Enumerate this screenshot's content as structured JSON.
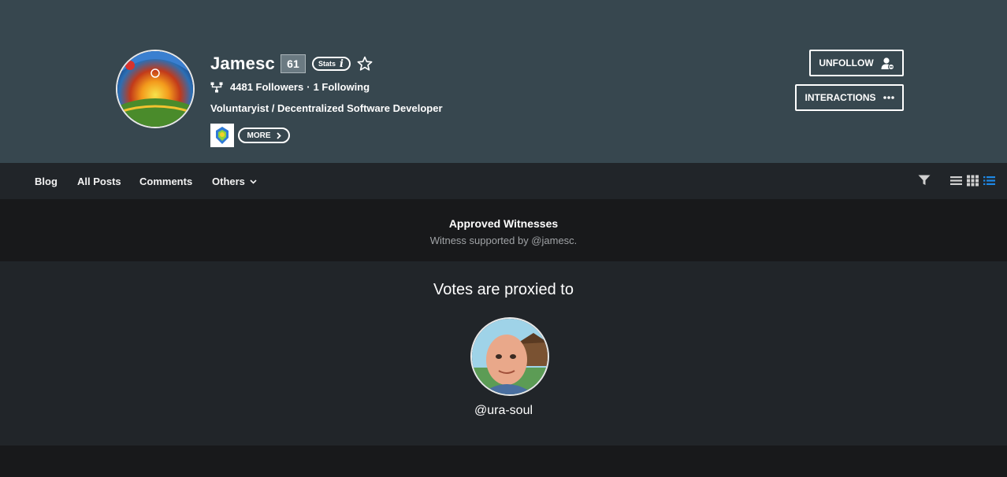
{
  "profile": {
    "name": "Jamesc",
    "reputation": "61",
    "stats_label": "Stats",
    "stats_info_glyph": "i",
    "followers_text": "4481 Followers",
    "separator": "·",
    "following_text": "1 Following",
    "bio": "Voluntaryist / Decentralized Software Developer",
    "more_label": "MORE"
  },
  "actions": {
    "unfollow_label": "UNFOLLOW",
    "interactions_label": "INTERACTIONS"
  },
  "tabs": [
    {
      "label": "Blog"
    },
    {
      "label": "All Posts"
    },
    {
      "label": "Comments"
    },
    {
      "label": "Others"
    }
  ],
  "view_modes": [
    "list-view",
    "grid-view",
    "compact-view"
  ],
  "active_view": "compact-view",
  "witness": {
    "title": "Approved Witnesses",
    "subtitle": "Witness supported by @jamesc."
  },
  "proxy": {
    "title": "Votes are proxied to",
    "account": "@ura-soul"
  },
  "colors": {
    "header_bg": "#37474f",
    "tabs_bg": "#212529",
    "page_bg": "#18191b",
    "accent": "#1e88e5"
  }
}
